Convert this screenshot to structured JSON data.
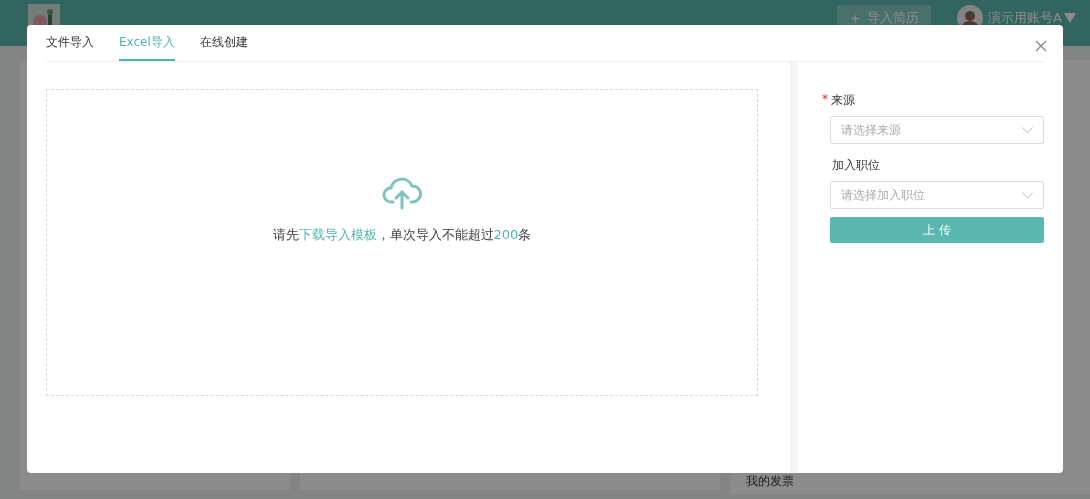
{
  "header": {
    "import_button": {
      "icon": "+",
      "label": "导入简历"
    },
    "user": {
      "name": "演示用账号A"
    }
  },
  "sidebar_item": "我的发票",
  "modal": {
    "tabs": [
      {
        "label": "文件导入",
        "selected": false
      },
      {
        "label": "Excel导入",
        "selected": true
      },
      {
        "label": "在线创建",
        "selected": false
      }
    ],
    "upload_hint": {
      "prefix": "请先",
      "link": "下载导入模板",
      "middle": "，单次导入不能超过",
      "count": "200",
      "suffix": "条"
    },
    "fields": [
      {
        "label": "来源",
        "required_mark": "*",
        "placeholder": "请选择来源"
      },
      {
        "label": "加入职位",
        "placeholder": "请选择加入职位"
      }
    ],
    "submit": "上 传"
  }
}
